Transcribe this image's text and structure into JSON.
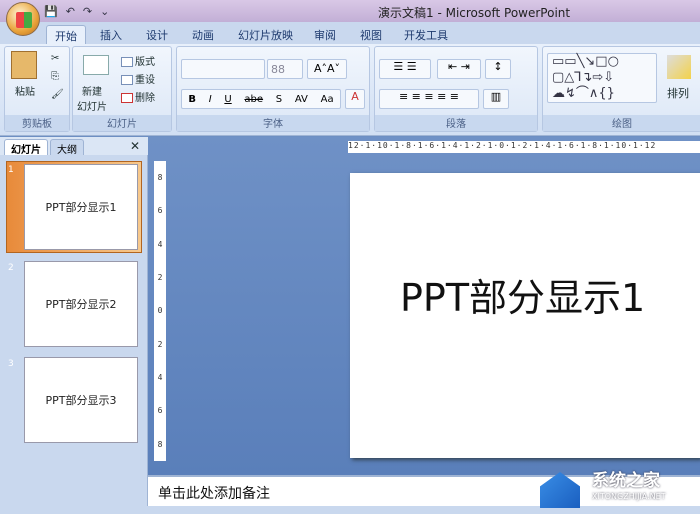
{
  "window": {
    "title": "演示文稿1 - Microsoft PowerPoint"
  },
  "qat": {
    "save": "💾",
    "undo": "↶",
    "redo": "↷",
    "more": "⌄"
  },
  "tabs": [
    "开始",
    "插入",
    "设计",
    "动画",
    "幻灯片放映",
    "审阅",
    "视图",
    "开发工具"
  ],
  "ribbon": {
    "clipboard": {
      "label": "剪贴板",
      "paste": "粘贴"
    },
    "slides": {
      "label": "幻灯片",
      "new_slide": "新建\n幻灯片",
      "layout": "版式",
      "reset": "重设",
      "delete": "删除"
    },
    "font": {
      "label": "字体",
      "font_name": "",
      "font_size": "88",
      "buttons": [
        "B",
        "I",
        "U",
        "abe",
        "S",
        "AV",
        "Aa"
      ]
    },
    "paragraph": {
      "label": "段落"
    },
    "drawing": {
      "label": "绘图",
      "arrange": "排列"
    }
  },
  "left_pane": {
    "tabs": [
      "幻灯片",
      "大纲"
    ],
    "close": "✕",
    "slides": [
      {
        "num": "1",
        "title": "PPT部分显示1"
      },
      {
        "num": "2",
        "title": "PPT部分显示2"
      },
      {
        "num": "3",
        "title": "PPT部分显示3"
      }
    ]
  },
  "editor": {
    "hruler": "12·1·10·1·8·1·6·1·4·1·2·1·0·1·2·1·4·1·6·1·8·1·10·1·12",
    "vruler": [
      "8",
      "6",
      "4",
      "2",
      "0",
      "2",
      "4",
      "6",
      "8"
    ],
    "slide_title": "PPT部分显示1"
  },
  "notes": {
    "placeholder": "单击此处添加备注"
  },
  "watermark": {
    "name": "系统之家",
    "url": "XITONGZHIJIA.NET"
  }
}
